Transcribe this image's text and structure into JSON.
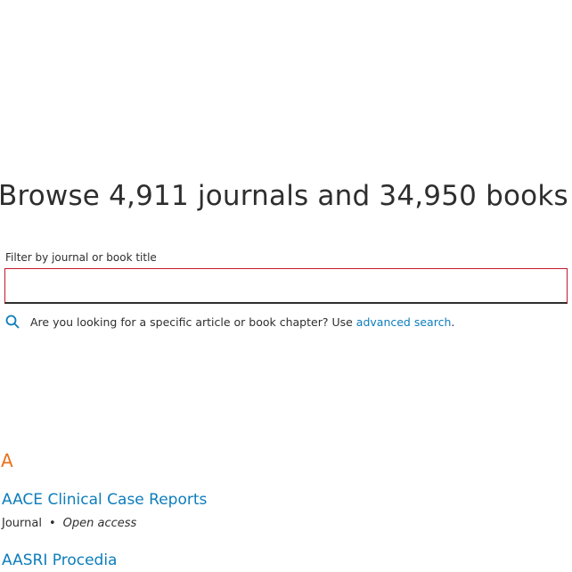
{
  "browse": {
    "heading": "Browse 4,911 journals and 34,950 books"
  },
  "filter": {
    "label": "Filter by journal or book title",
    "value": "",
    "placeholder": ""
  },
  "hint": {
    "icon": "search-icon",
    "text": "Are you looking for a specific article or book chapter? Use",
    "link_text": "advanced search",
    "suffix": "."
  },
  "list": {
    "letter": "A",
    "items": [
      {
        "title": "AACE Clinical Case Reports",
        "type": "Journal",
        "separator": "•",
        "access": "Open access"
      },
      {
        "title": "AASRI Procedia"
      }
    ]
  },
  "colors": {
    "link": "#0c7dbb",
    "letter": "#e9711c",
    "input_border": "#c4182b",
    "text": "#2e2e2e"
  }
}
